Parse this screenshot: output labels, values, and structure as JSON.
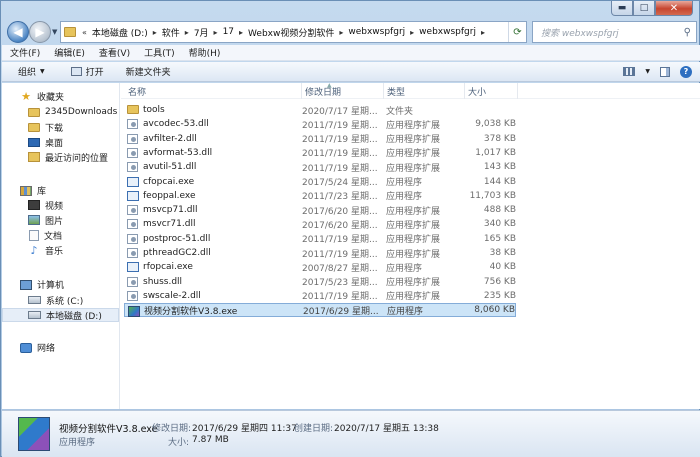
{
  "window": {
    "controls": {
      "minimize": "▬",
      "maximize": "□",
      "close": "✕"
    }
  },
  "address": {
    "prefix": "«",
    "crumbs": [
      "本地磁盘 (D:)",
      "软件",
      "7月",
      "17",
      "Webxw视频分割软件",
      "webxwspfgrj",
      "webxwspfgrj"
    ],
    "separator": "▸"
  },
  "search": {
    "placeholder": "搜索 webxwspfgrj"
  },
  "menu": [
    "文件(F)",
    "编辑(E)",
    "查看(V)",
    "工具(T)",
    "帮助(H)"
  ],
  "toolbar": {
    "organize": "组织",
    "open": "打开",
    "new_folder": "新建文件夹",
    "help": "?"
  },
  "navpane": {
    "favorites": {
      "label": "收藏夹",
      "items": [
        "2345Downloads",
        "下载",
        "桌面",
        "最近访问的位置"
      ]
    },
    "libraries": {
      "label": "库",
      "items": [
        "视频",
        "图片",
        "文档",
        "音乐"
      ]
    },
    "computer": {
      "label": "计算机",
      "items": [
        "系统 (C:)",
        "本地磁盘 (D:)"
      ]
    },
    "network": {
      "label": "网络"
    }
  },
  "columns": {
    "name": "名称",
    "date": "修改日期",
    "type": "类型",
    "size": "大小"
  },
  "files": [
    {
      "name": "tools",
      "date": "2020/7/17 星期...",
      "type": "文件夹",
      "size": "",
      "icon": "folder"
    },
    {
      "name": "avcodec-53.dll",
      "date": "2011/7/19 星期...",
      "type": "应用程序扩展",
      "size": "9,038 KB",
      "icon": "dll"
    },
    {
      "name": "avfilter-2.dll",
      "date": "2011/7/19 星期...",
      "type": "应用程序扩展",
      "size": "378 KB",
      "icon": "dll"
    },
    {
      "name": "avformat-53.dll",
      "date": "2011/7/19 星期...",
      "type": "应用程序扩展",
      "size": "1,017 KB",
      "icon": "dll"
    },
    {
      "name": "avutil-51.dll",
      "date": "2011/7/19 星期...",
      "type": "应用程序扩展",
      "size": "143 KB",
      "icon": "dll"
    },
    {
      "name": "cfopcai.exe",
      "date": "2017/5/24 星期...",
      "type": "应用程序",
      "size": "144 KB",
      "icon": "exe"
    },
    {
      "name": "feoppal.exe",
      "date": "2011/7/23 星期...",
      "type": "应用程序",
      "size": "11,703 KB",
      "icon": "exe"
    },
    {
      "name": "msvcp71.dll",
      "date": "2017/6/20 星期...",
      "type": "应用程序扩展",
      "size": "488 KB",
      "icon": "dll"
    },
    {
      "name": "msvcr71.dll",
      "date": "2017/6/20 星期...",
      "type": "应用程序扩展",
      "size": "340 KB",
      "icon": "dll"
    },
    {
      "name": "postproc-51.dll",
      "date": "2011/7/19 星期...",
      "type": "应用程序扩展",
      "size": "165 KB",
      "icon": "dll"
    },
    {
      "name": "pthreadGC2.dll",
      "date": "2011/7/19 星期...",
      "type": "应用程序扩展",
      "size": "38 KB",
      "icon": "dll"
    },
    {
      "name": "rfopcai.exe",
      "date": "2007/8/27 星期...",
      "type": "应用程序",
      "size": "40 KB",
      "icon": "exe"
    },
    {
      "name": "shuss.dll",
      "date": "2017/5/23 星期...",
      "type": "应用程序扩展",
      "size": "756 KB",
      "icon": "dll"
    },
    {
      "name": "swscale-2.dll",
      "date": "2011/7/19 星期...",
      "type": "应用程序扩展",
      "size": "235 KB",
      "icon": "dll"
    },
    {
      "name": "视频分割软件V3.8.exe",
      "date": "2017/6/29 星期...",
      "type": "应用程序",
      "size": "8,060 KB",
      "icon": "app",
      "selected": true
    }
  ],
  "details": {
    "name": "视频分割软件V3.8.exe",
    "type": "应用程序",
    "modified_label": "修改日期:",
    "modified": "2017/6/29 星期四 11:37",
    "created_label": "创建日期:",
    "created": "2020/7/17 星期五 13:38",
    "size_label": "大小:",
    "size": "7.87 MB"
  }
}
